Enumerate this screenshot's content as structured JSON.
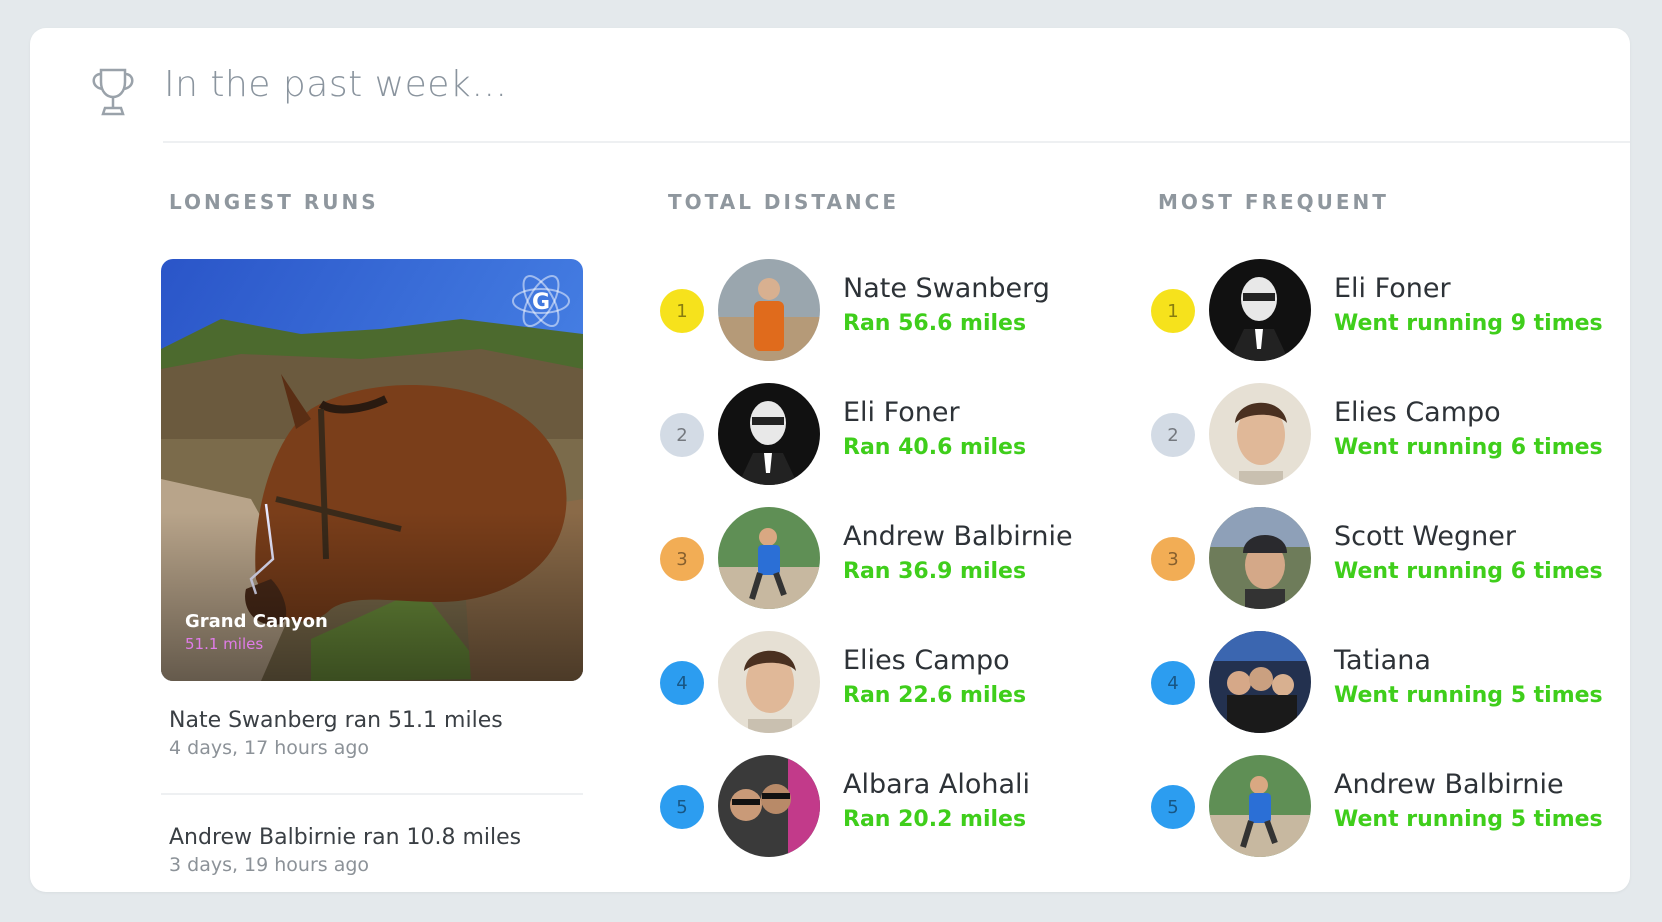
{
  "header": {
    "title": "In the past week…"
  },
  "columns": {
    "longest": {
      "title": "LONGEST RUNS"
    },
    "distance": {
      "title": "TOTAL DISTANCE"
    },
    "frequent": {
      "title": "MOST FREQUENT"
    }
  },
  "feature": {
    "location": "Grand Canyon",
    "distance": "51.1 miles",
    "badge": "G"
  },
  "runs": [
    {
      "title": "Nate Swanberg ran 51.1 miles",
      "time": "4 days, 17 hours ago"
    },
    {
      "title": "Andrew Balbirnie ran 10.8 miles",
      "time": "3 days, 19 hours ago"
    }
  ],
  "distance": [
    {
      "rank": "1",
      "name": "Nate Swanberg",
      "stat": "Ran 56.6 miles"
    },
    {
      "rank": "2",
      "name": "Eli Foner",
      "stat": "Ran 40.6 miles"
    },
    {
      "rank": "3",
      "name": "Andrew Balbirnie",
      "stat": "Ran 36.9 miles"
    },
    {
      "rank": "4",
      "name": "Elies Campo",
      "stat": "Ran 22.6 miles"
    },
    {
      "rank": "5",
      "name": "Albara Alohali",
      "stat": "Ran 20.2 miles"
    }
  ],
  "frequent": [
    {
      "rank": "1",
      "name": "Eli Foner",
      "stat": "Went running 9 times"
    },
    {
      "rank": "2",
      "name": "Elies Campo",
      "stat": "Went running 6 times"
    },
    {
      "rank": "3",
      "name": "Scott Wegner",
      "stat": "Went running 6 times"
    },
    {
      "rank": "4",
      "name": "Tatiana",
      "stat": "Went running 5 times"
    },
    {
      "rank": "5",
      "name": "Andrew Balbirnie",
      "stat": "Went running 5 times"
    }
  ],
  "colors": {
    "accent_green": "#3fce1b",
    "rank1": "#f6e21c",
    "rank2": "#d3dbe5",
    "rank3": "#f2ad55",
    "rank4": "#2c9df0",
    "rank5": "#2c9df0"
  },
  "icons": {
    "header": "trophy-icon",
    "feature_badge": "gyroscope-logo-icon"
  }
}
